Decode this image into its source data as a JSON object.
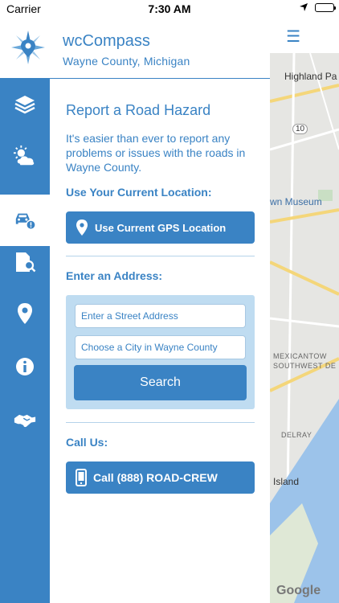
{
  "status_bar": {
    "carrier": "Carrier",
    "time": "7:30 AM"
  },
  "header": {
    "title": "wcCompass",
    "subtitle": "Wayne County, Michigan",
    "menu_icon": "☰"
  },
  "sidebar": {
    "items": [
      {
        "icon": "layers-icon"
      },
      {
        "icon": "weather-icon"
      },
      {
        "icon": "car-hazard-icon",
        "active": true
      },
      {
        "icon": "document-search-icon"
      },
      {
        "icon": "location-pin-icon"
      },
      {
        "icon": "info-icon"
      },
      {
        "icon": "handshake-icon"
      }
    ]
  },
  "panel": {
    "title": "Report a Road Hazard",
    "description": "It's easier than ever to report any problems or issues with the roads in Wayne County.",
    "location_label": "Use Your Current Location:",
    "gps_button": "Use Current GPS Location",
    "address_label": "Enter an Address:",
    "street_placeholder": "Enter a Street Address",
    "city_placeholder": "Choose a City in Wayne County",
    "search_button": "Search",
    "call_label": "Call Us:",
    "call_button": "Call (888) ROAD-CREW"
  },
  "map": {
    "labels": {
      "highland": "Highland Pa",
      "route": "10",
      "museum": "wn Museum",
      "mexicantown": "MEXICANTOW",
      "southwest": "SOUTHWEST DE",
      "delray": "DELRAY",
      "island": "Island"
    },
    "attribution": "Google"
  },
  "colors": {
    "primary": "#3a83c4",
    "light": "#bfdcf1"
  }
}
